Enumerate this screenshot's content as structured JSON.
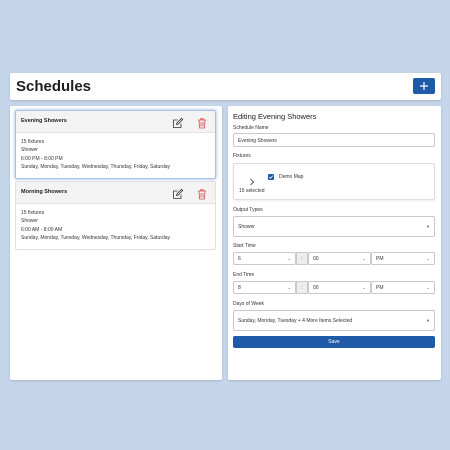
{
  "header": {
    "title": "Schedules",
    "add_icon": "plus-icon"
  },
  "schedules": [
    {
      "name": "Evening Showers",
      "fixtures": "15 fixtures",
      "type": "Shower",
      "time": "6:00 PM - 8:00 PM",
      "days": "Sunday, Monday, Tuesday, Wednesday, Thursday, Friday, Saturday",
      "selected": true
    },
    {
      "name": "Morning Showers",
      "fixtures": "15 fixtures",
      "type": "Shower",
      "time": "6:00 AM - 8:00 AM",
      "days": "Sunday, Monday, Tuesday, Wednesday, Thursday, Friday, Saturday",
      "selected": false
    }
  ],
  "editor": {
    "title": "Editing Evening Showers",
    "schedule_name_label": "Schedule Name",
    "schedule_name_value": "Evening Showers",
    "fixtures_label": "Fixtures",
    "fixture_tree_item": "Demo Map",
    "fixtures_selected": "15 selected",
    "output_types_label": "Output Types",
    "output_type_value": "Shower",
    "start_time_label": "Start Time",
    "start_hour": "6",
    "start_minute": "00",
    "start_ampm": "PM",
    "end_time_label": "End Time",
    "end_hour": "8",
    "end_minute": "00",
    "end_ampm": "PM",
    "time_separator": ":",
    "days_label": "Days of Week",
    "days_value": "Sunday, Monday, Tuesday + 4 More Items Selected",
    "save_label": "Save"
  },
  "colors": {
    "accent": "#1e5aa8",
    "delete": "#d84a4a",
    "background": "#c5d5ea"
  }
}
